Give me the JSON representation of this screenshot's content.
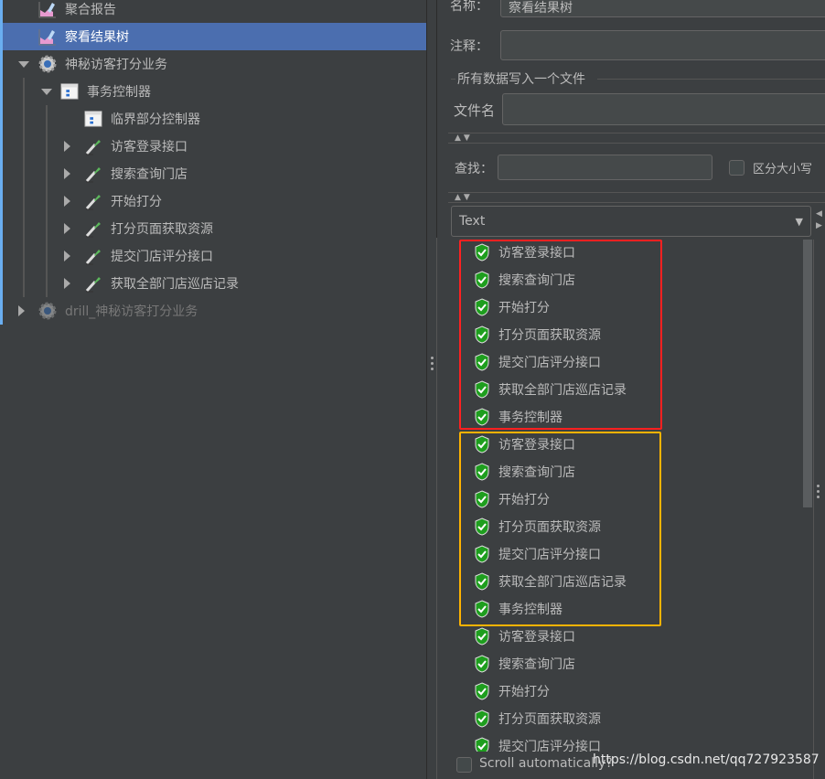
{
  "tree": {
    "items": [
      {
        "label": "聚合报告",
        "icon": "graph-report-icon",
        "selected": false
      },
      {
        "label": "察看结果树",
        "icon": "graph-report-icon",
        "selected": true
      },
      {
        "label": "神秘访客打分业务",
        "icon": "gear-icon",
        "expanded": true
      },
      {
        "label": "事务控制器",
        "icon": "controller-icon",
        "expanded": true
      },
      {
        "label": "临界部分控制器",
        "icon": "controller-icon"
      },
      {
        "label": "访客登录接口",
        "icon": "pipette-sampler-icon"
      },
      {
        "label": "搜索查询门店",
        "icon": "pipette-sampler-icon"
      },
      {
        "label": "开始打分",
        "icon": "pipette-sampler-icon"
      },
      {
        "label": "打分页面获取资源",
        "icon": "pipette-sampler-icon"
      },
      {
        "label": "提交门店评分接口",
        "icon": "pipette-sampler-icon"
      },
      {
        "label": "获取全部门店巡店记录",
        "icon": "pipette-sampler-icon"
      },
      {
        "label": "drill_神秘访客打分业务",
        "icon": "gear-icon",
        "disabled": true
      }
    ]
  },
  "form": {
    "name_label": "名称：",
    "name_value": "察看结果树",
    "comment_label": "注释：",
    "comment_value": "",
    "fieldset_title": "所有数据写入一个文件",
    "filename_label": "文件名",
    "filename_value": "",
    "search_label": "查找：",
    "search_value": "",
    "case_label": "区分大小写",
    "case_checked": false,
    "renderer_value": "Text"
  },
  "results": [
    "访客登录接口",
    "搜索查询门店",
    "开始打分",
    "打分页面获取资源",
    "提交门店评分接口",
    "获取全部门店巡店记录",
    "事务控制器",
    "访客登录接口",
    "搜索查询门店",
    "开始打分",
    "打分页面获取资源",
    "提交门店评分接口",
    "获取全部门店巡店记录",
    "事务控制器",
    "访客登录接口",
    "搜索查询门店",
    "开始打分",
    "打分页面获取资源",
    "提交门店评分接口"
  ],
  "colors": {
    "selection": "#4b6eaf",
    "success": "#1e9e1e",
    "highlight_red": "#ff2020",
    "highlight_orange": "#ffb300"
  },
  "bottom": {
    "scroll_label": "Scroll automatically?",
    "scroll_checked": false
  },
  "watermark": "https://blog.csdn.net/qq727923587"
}
